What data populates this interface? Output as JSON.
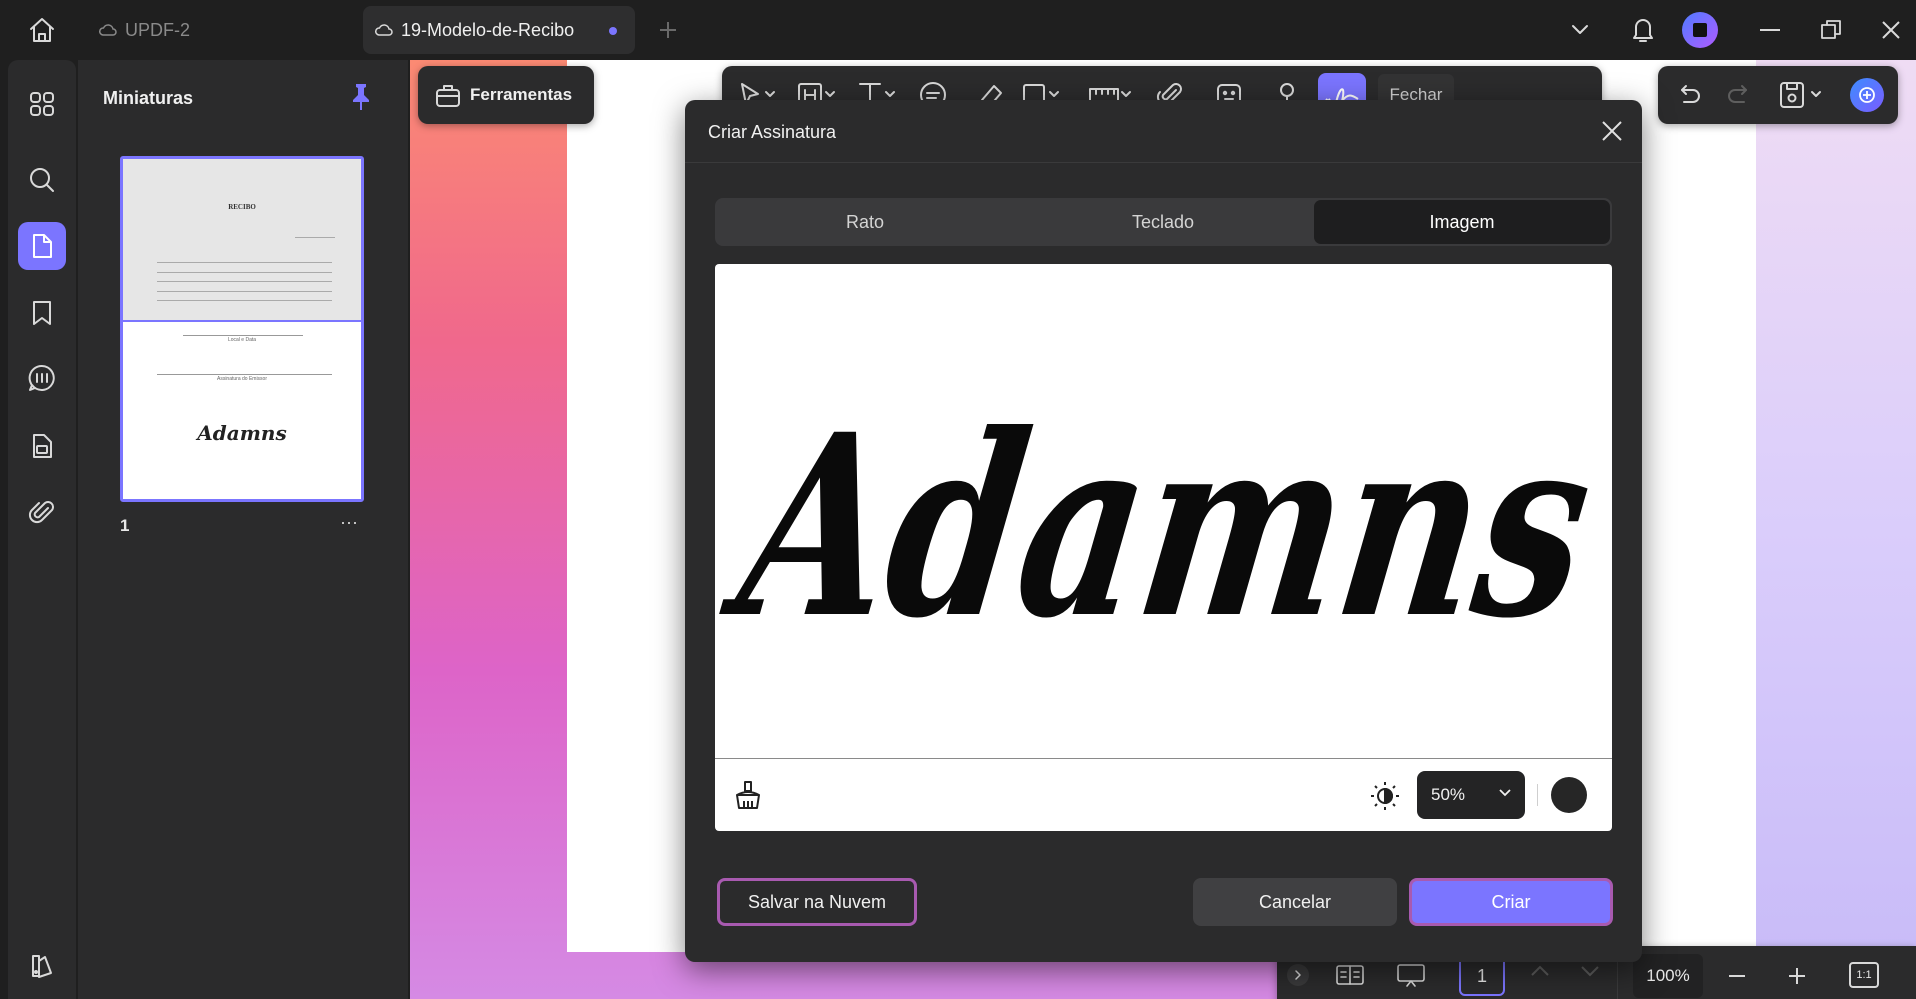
{
  "titlebar": {
    "tabs": [
      {
        "label": "UPDF-2",
        "icon": "cloud-icon",
        "active": false
      },
      {
        "label": "19-Modelo-de-Recibo",
        "icon": "cloud-icon",
        "active": true
      }
    ],
    "icons": [
      "home-icon",
      "plus-icon",
      "chevron-down-icon",
      "bell-icon",
      "app-logo",
      "minimize-icon",
      "restore-icon",
      "close-icon"
    ]
  },
  "rail": {
    "items": [
      "thumbnails-grid-icon",
      "search-icon",
      "page-icon",
      "bookmark-icon",
      "comment-icon",
      "form-icon",
      "attachment-icon",
      "theme-icon"
    ],
    "active_index": 2
  },
  "thumbnails": {
    "title": "Miniaturas",
    "page_number": "1",
    "more_label": "···",
    "doc_heading": "RECIBO",
    "doc_sig": "Adamns",
    "doc_place_date": "Local e Data",
    "doc_signer": "Assinatura do Emissor"
  },
  "tools": {
    "label": "Ferramentas",
    "close_label": "Fechar"
  },
  "dialog": {
    "title": "Criar Assinatura",
    "tabs": [
      "Rato",
      "Teclado",
      "Imagem"
    ],
    "active_tab": 2,
    "signature_text": "Adamns",
    "opacity_value": "50%",
    "color": "#262626",
    "save_cloud_label": "Salvar na Nuvem",
    "cancel_label": "Cancelar",
    "create_label": "Criar"
  },
  "bottombar": {
    "page_input": "1",
    "zoom": "100%",
    "fit_label": "1:1"
  },
  "colors": {
    "accent": "#7b75ff",
    "highlight_border": "#a85ab0",
    "panel": "#2b2b2c",
    "background": "#1f1f1f"
  }
}
